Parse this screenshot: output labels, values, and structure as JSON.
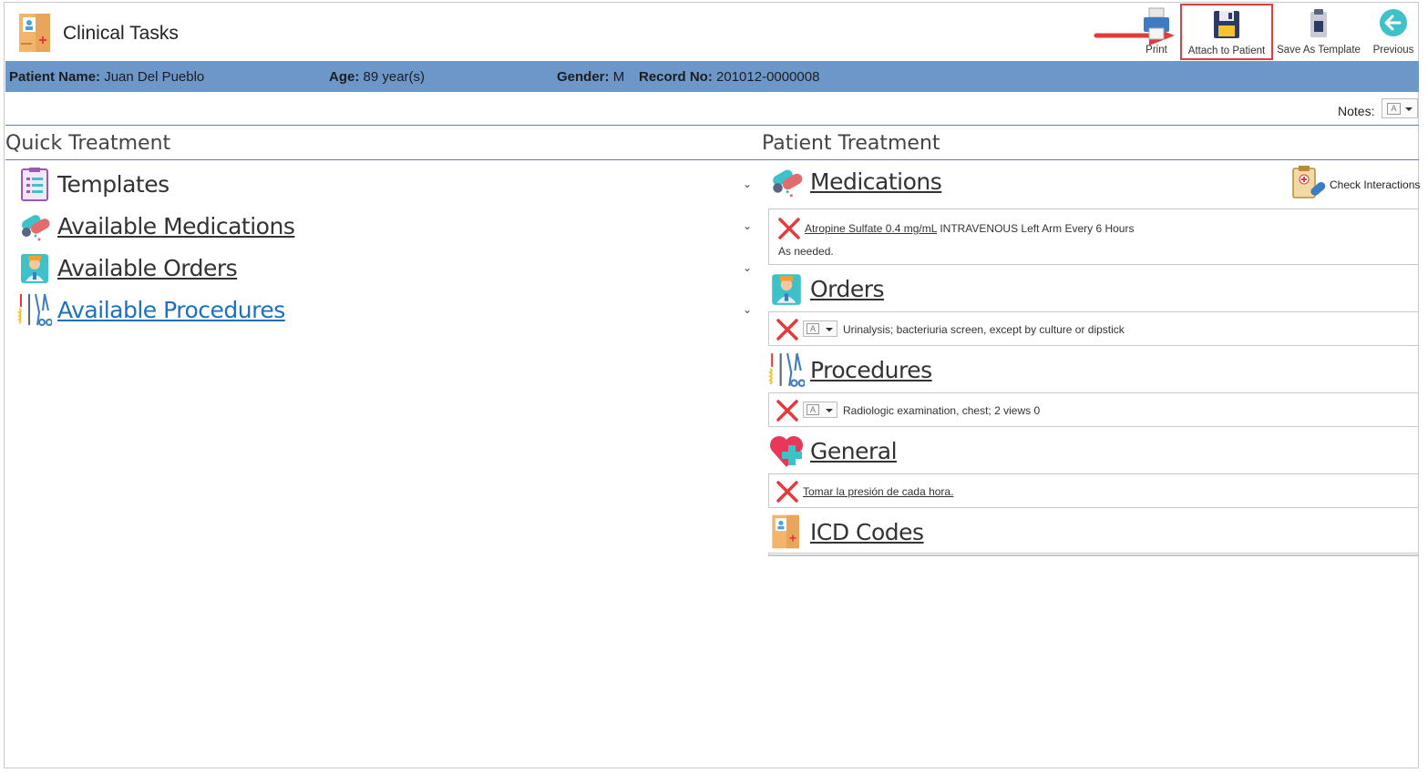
{
  "app": {
    "title": "Clinical Tasks"
  },
  "toolbar": {
    "print_label": "Print",
    "attach_label": "Attach to Patient",
    "save_template_label": "Save As Template",
    "previous_label": "Previous"
  },
  "patient": {
    "name_label": "Patient Name:",
    "name": "Juan Del Pueblo",
    "age_label": "Age:",
    "age": "89 year(s)",
    "gender_label": "Gender:",
    "gender": "M",
    "record_label": "Record No:",
    "record": "201012-0000008"
  },
  "notes": {
    "label": "Notes:"
  },
  "quick_treatment": {
    "title": "Quick Treatment",
    "items": [
      {
        "label": "Templates",
        "icon": "clipboard-list-icon"
      },
      {
        "label": "Available Medications",
        "icon": "pills-icon"
      },
      {
        "label": "Available Orders",
        "icon": "doctor-icon"
      },
      {
        "label": "Available Procedures",
        "icon": "surgical-tools-icon"
      }
    ]
  },
  "patient_treatment": {
    "title": "Patient Treatment",
    "check_interactions": "Check Interactions",
    "medications": {
      "title": "Medications",
      "items": [
        {
          "drug": "Atropine Sulfate  0.4 mg/mL",
          "details": "INTRAVENOUS Left Arm Every 6 Hours",
          "note": "As needed."
        }
      ]
    },
    "orders": {
      "title": "Orders",
      "items": [
        {
          "text": "Urinalysis; bacteriuria screen, except by culture or dipstick"
        }
      ]
    },
    "procedures": {
      "title": "Procedures",
      "items": [
        {
          "text": "Radiologic examination, chest; 2 views 0"
        }
      ]
    },
    "general": {
      "title": "General",
      "items": [
        {
          "text": "Tomar la presión de cada hora."
        }
      ]
    },
    "icd_codes": {
      "title": "ICD Codes"
    }
  },
  "colors": {
    "patient_bar": "#6e97c9",
    "highlight": "#e23b3b",
    "link_blue": "#1f6fbf",
    "delete_red": "#e8383d"
  }
}
